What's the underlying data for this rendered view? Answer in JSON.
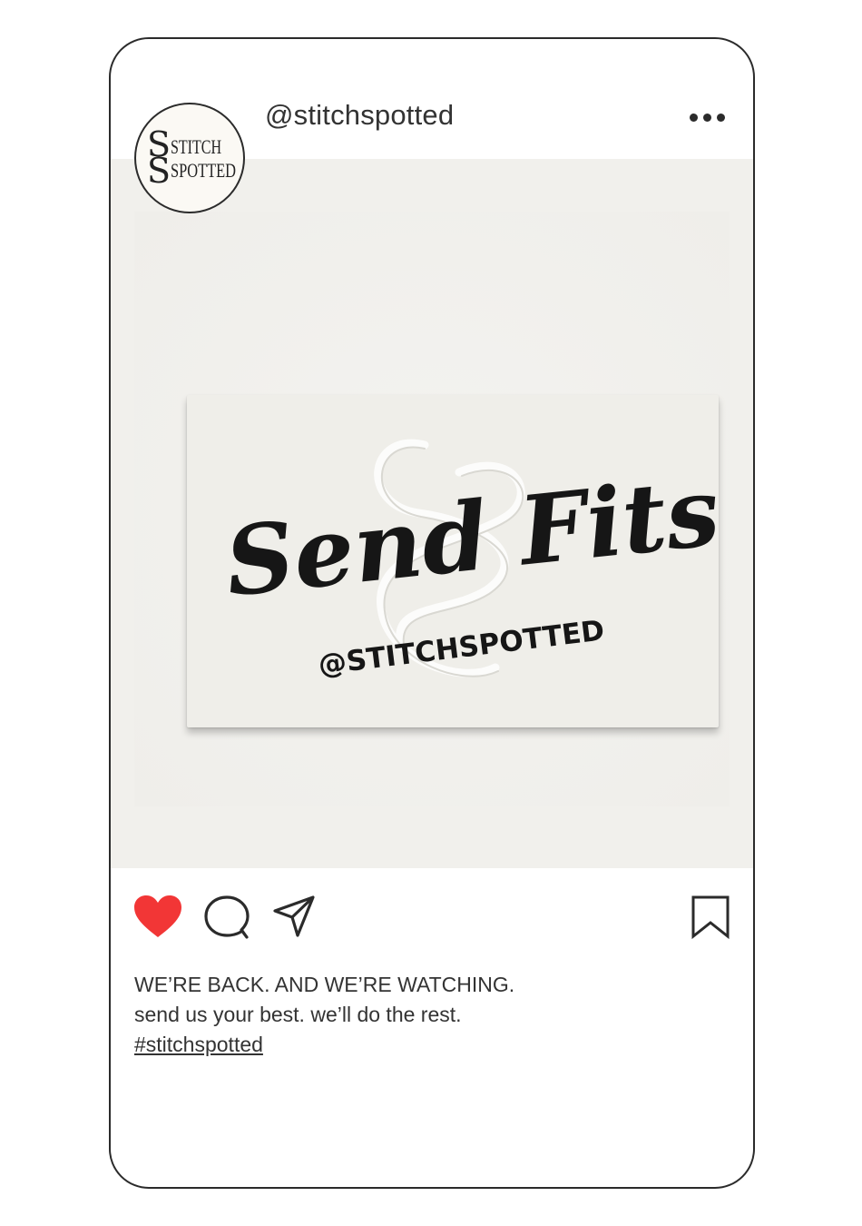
{
  "post": {
    "username": "@stitchspotted",
    "avatar": {
      "logo_line1": "STITCH",
      "logo_line2": "SPOTTED"
    },
    "image": {
      "card_headline": "Send Fits!",
      "card_handle": "@STITCHSPOTTED",
      "background_color": "#f1f0ec"
    },
    "actions": {
      "like_icon": "heart-icon",
      "liked": true,
      "like_color": "#f23636",
      "comment_icon": "comment-icon",
      "share_icon": "paper-plane-icon",
      "save_icon": "bookmark-icon"
    },
    "caption": {
      "line1": "WE’RE BACK. AND WE’RE WATCHING.",
      "line2": "send us your best. we’ll do the rest.",
      "hashtag": "#stitchspotted"
    },
    "more_icon": "more-options-icon"
  }
}
